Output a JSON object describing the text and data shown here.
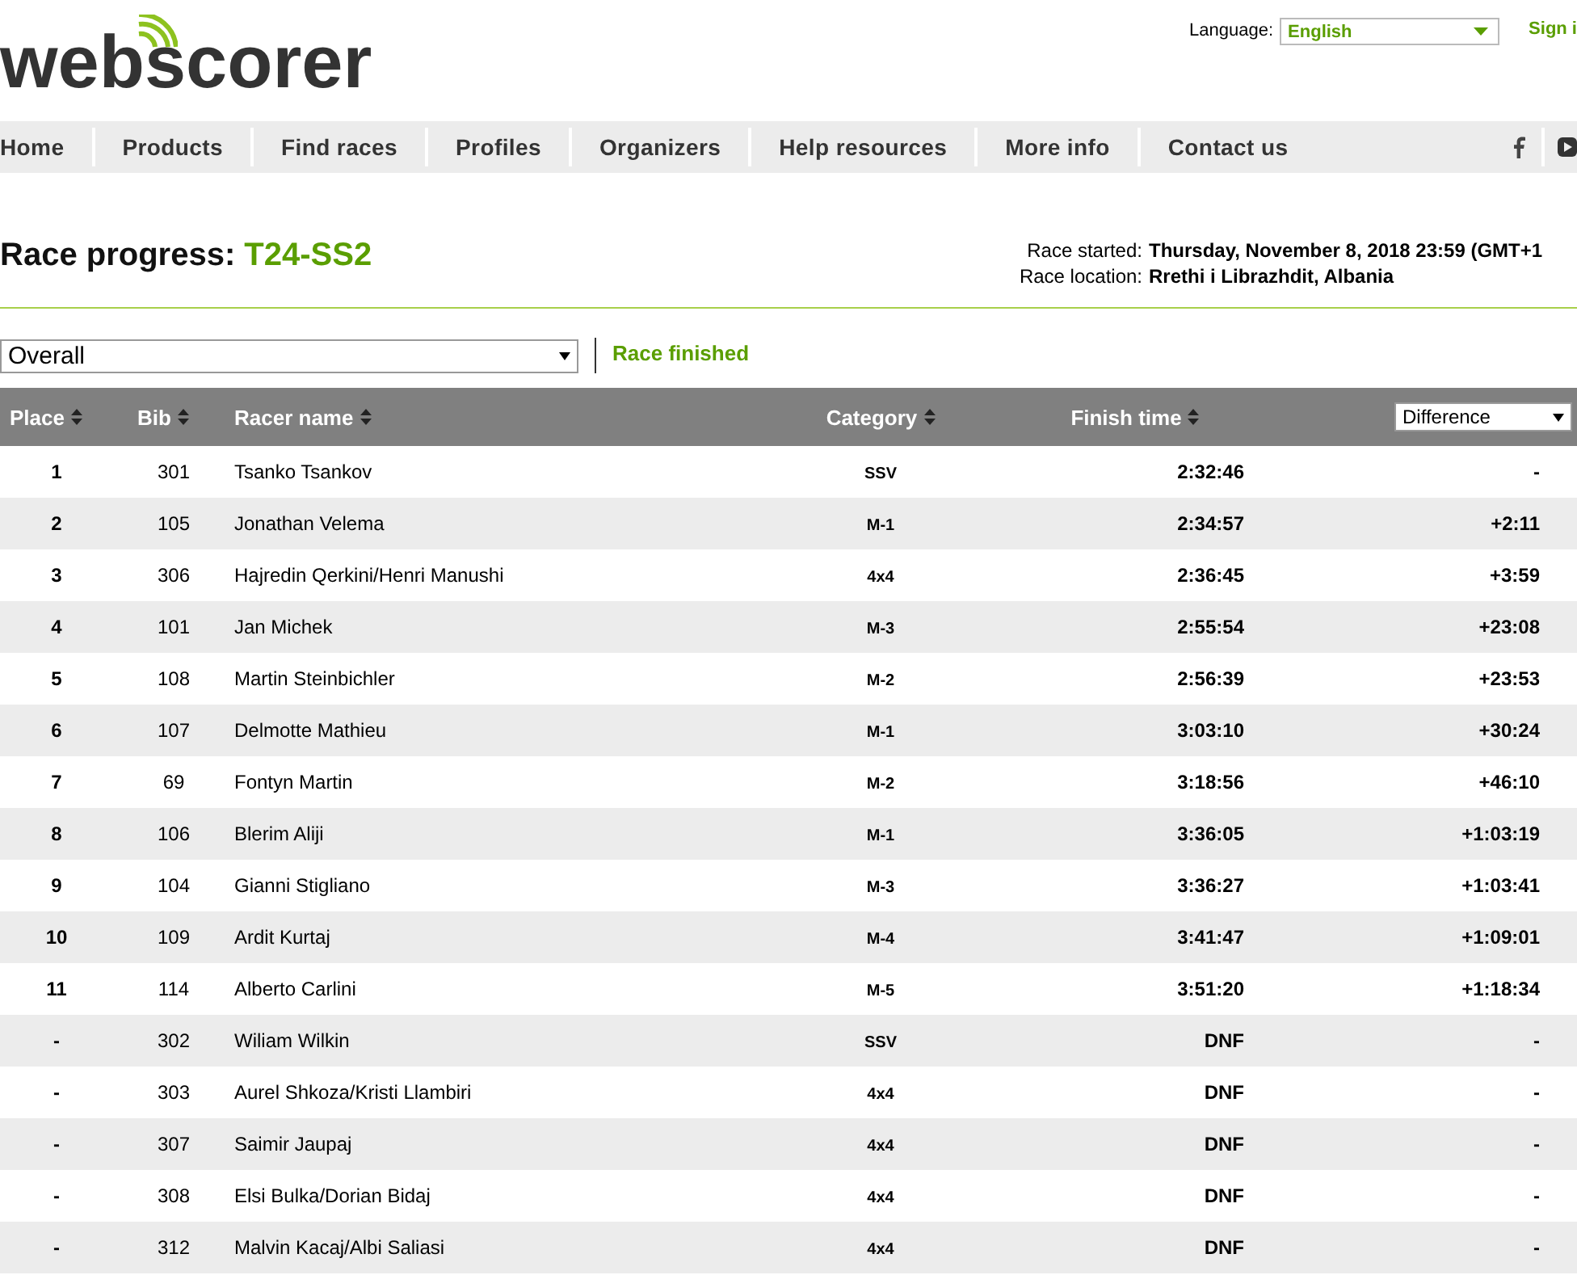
{
  "logo": "webscorer",
  "language": {
    "label": "Language:",
    "value": "English"
  },
  "sign_in": "Sign i",
  "nav": [
    "Home",
    "Products",
    "Find races",
    "Profiles",
    "Organizers",
    "Help resources",
    "More info",
    "Contact us"
  ],
  "title": {
    "prefix": "Race progress:",
    "race": "T24-SS2"
  },
  "info": [
    {
      "label": "Race started:",
      "value": "Thursday, November 8, 2018 23:59 (GMT+1"
    },
    {
      "label": "Race location:",
      "value": "Rrethi i Librazhdit, Albania"
    }
  ],
  "filter": {
    "value": "Overall"
  },
  "status": "Race finished",
  "columns": [
    "Place",
    "Bib",
    "Racer name",
    "Category",
    "Finish time"
  ],
  "diff_select": "Difference",
  "rows": [
    {
      "place": "1",
      "bib": "301",
      "name": "Tsanko Tsankov",
      "category": "SSV",
      "time": "2:32:46",
      "diff": "-"
    },
    {
      "place": "2",
      "bib": "105",
      "name": "Jonathan Velema",
      "category": "M-1",
      "time": "2:34:57",
      "diff": "+2:11"
    },
    {
      "place": "3",
      "bib": "306",
      "name": "Hajredin Qerkini/Henri Manushi",
      "category": "4x4",
      "time": "2:36:45",
      "diff": "+3:59"
    },
    {
      "place": "4",
      "bib": "101",
      "name": "Jan Michek",
      "category": "M-3",
      "time": "2:55:54",
      "diff": "+23:08"
    },
    {
      "place": "5",
      "bib": "108",
      "name": "Martin Steinbichler",
      "category": "M-2",
      "time": "2:56:39",
      "diff": "+23:53"
    },
    {
      "place": "6",
      "bib": "107",
      "name": "Delmotte Mathieu",
      "category": "M-1",
      "time": "3:03:10",
      "diff": "+30:24"
    },
    {
      "place": "7",
      "bib": "69",
      "name": "Fontyn Martin",
      "category": "M-2",
      "time": "3:18:56",
      "diff": "+46:10"
    },
    {
      "place": "8",
      "bib": "106",
      "name": "Blerim Aliji",
      "category": "M-1",
      "time": "3:36:05",
      "diff": "+1:03:19"
    },
    {
      "place": "9",
      "bib": "104",
      "name": "Gianni Stigliano",
      "category": "M-3",
      "time": "3:36:27",
      "diff": "+1:03:41"
    },
    {
      "place": "10",
      "bib": "109",
      "name": "Ardit Kurtaj",
      "category": "M-4",
      "time": "3:41:47",
      "diff": "+1:09:01"
    },
    {
      "place": "11",
      "bib": "114",
      "name": "Alberto Carlini",
      "category": "M-5",
      "time": "3:51:20",
      "diff": "+1:18:34"
    },
    {
      "place": "-",
      "bib": "302",
      "name": "Wiliam Wilkin",
      "category": "SSV",
      "time": "DNF",
      "diff": "-"
    },
    {
      "place": "-",
      "bib": "303",
      "name": "Aurel Shkoza/Kristi Llambiri",
      "category": "4x4",
      "time": "DNF",
      "diff": "-"
    },
    {
      "place": "-",
      "bib": "307",
      "name": "Saimir Jaupaj",
      "category": "4x4",
      "time": "DNF",
      "diff": "-"
    },
    {
      "place": "-",
      "bib": "308",
      "name": "Elsi Bulka/Dorian Bidaj",
      "category": "4x4",
      "time": "DNF",
      "diff": "-"
    },
    {
      "place": "-",
      "bib": "312",
      "name": "Malvin Kacaj/Albi Saliasi",
      "category": "4x4",
      "time": "DNF",
      "diff": "-"
    }
  ]
}
